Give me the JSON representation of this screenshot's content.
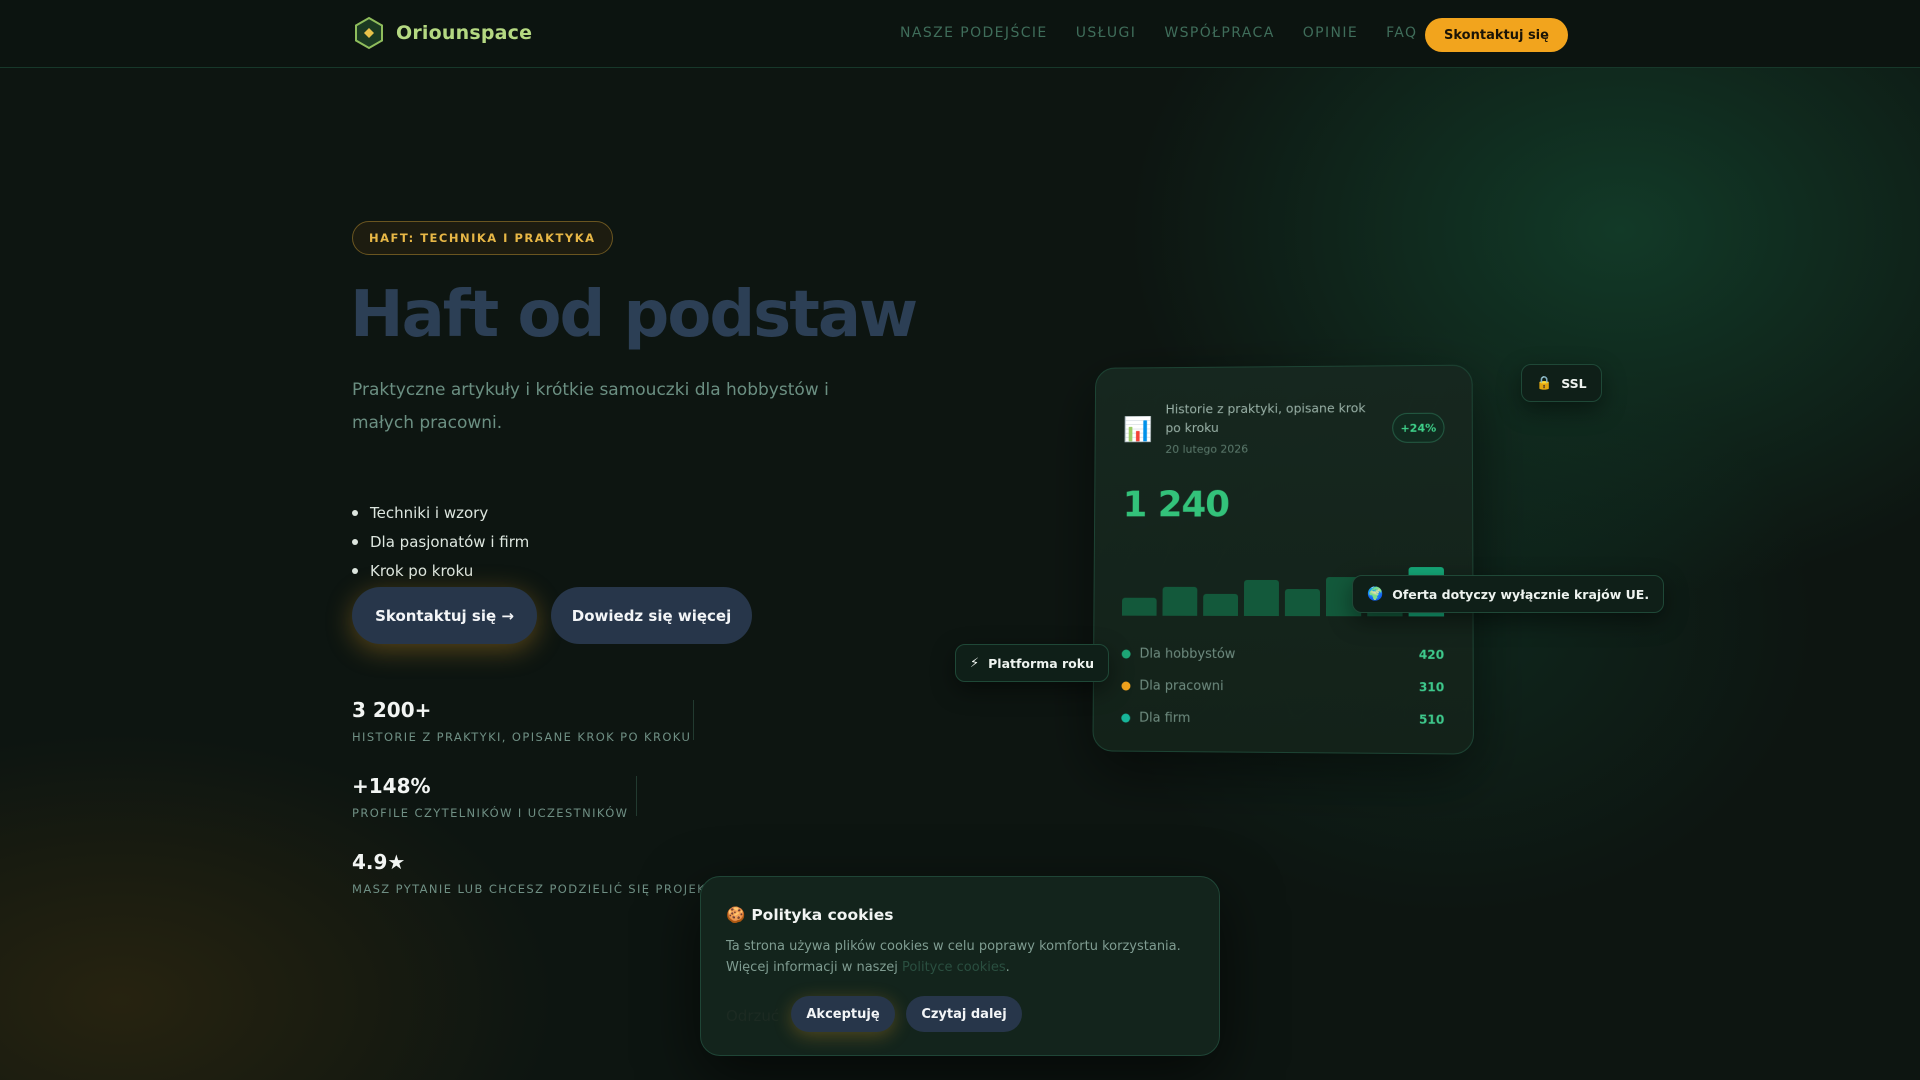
{
  "nav": {
    "brand": "Oriounspace",
    "logo_icon": "hexagon-logo-icon",
    "menu": [
      "NASZE PODEJŚCIE",
      "USŁUGI",
      "WSPÓŁPRACA",
      "OPINIE",
      "FAQ"
    ],
    "cta": "Skontaktuj się"
  },
  "hero": {
    "eyebrow": "HAFT: TECHNIKA I PRAKTYKA",
    "title": "Haft od podstaw",
    "subtitle": "Praktyczne artykuły i krótkie samouczki dla hobbystów i małych pracowni.",
    "bullets": [
      "Techniki i wzory",
      "Dla pasjonatów i firm",
      "Krok po kroku"
    ],
    "primary_cta": "Skontaktuj się →",
    "secondary_cta": "Dowiedz się więcej"
  },
  "stats": [
    {
      "value": "3 200+",
      "label": "HISTORIE Z PRAKTYKI, OPISANE KROK PO KROKU"
    },
    {
      "value": "+148%",
      "label": "PROFILE CZYTELNIKÓW I UCZESTNIKÓW"
    },
    {
      "value": "4.9★",
      "label": "MASZ PYTANIE LUB CHCESZ PODZIELIĆ SIĘ PROJEKTEM"
    }
  ],
  "card": {
    "icon": "bar-chart-icon",
    "title": "Historie z praktyki, opisane krok po kroku",
    "date": "20 lutego 2026",
    "badge": "+24%",
    "total": "1 240",
    "bars": [
      0.3,
      0.48,
      0.36,
      0.6,
      0.45,
      0.65,
      0.55,
      0.82
    ],
    "legend": [
      {
        "label": "Dla hobbystów",
        "value": "420",
        "color": "#1ea877"
      },
      {
        "label": "Dla pracowni",
        "value": "310",
        "color": "#f2a41d"
      },
      {
        "label": "Dla firm",
        "value": "510",
        "color": "#17b59a"
      }
    ]
  },
  "chips": {
    "ssl": "SSL",
    "ssl_icon": "lock-icon",
    "eu": "Oferta dotyczy wyłącznie krajów UE.",
    "eu_icon": "globe-icon",
    "platform": "Platforma roku",
    "platform_icon": "lightning-icon"
  },
  "cookie": {
    "title": "Polityka cookies",
    "icon": "cookie-icon",
    "text_before": "Ta strona używa plików cookies w celu poprawy komfortu korzystania. Więcej informacji w naszej ",
    "link": "Polityce cookies",
    "text_after": ".",
    "decline": "Odrzuć",
    "accept": "Akceptuję",
    "more": "Czytaj dalej"
  },
  "colors": {
    "accent": "#f2a41d",
    "brand": "#b5d982",
    "positive": "#33c27a",
    "button": "#27364a"
  }
}
